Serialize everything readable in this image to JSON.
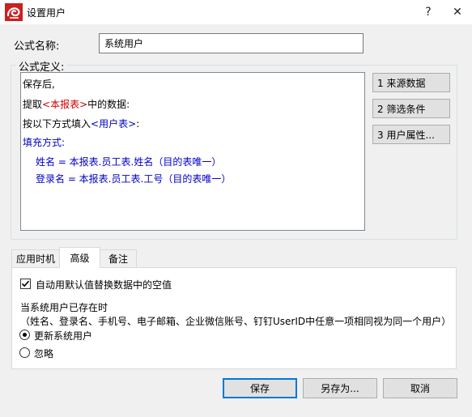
{
  "window": {
    "title": "设置用户",
    "help_label": "?",
    "close_label": "✕"
  },
  "formula_name": {
    "label": "公式名称:",
    "value": "系统用户"
  },
  "definition": {
    "label": "公式定义:",
    "lines": {
      "l1": {
        "text": "保存后,"
      },
      "l2": {
        "prefix": "提取",
        "highlight": "<本报表>",
        "suffix": "中的数据:"
      },
      "l3": {
        "prefix": "按以下方式填入",
        "highlight": "<用户表>",
        "suffix": ":"
      },
      "l4": {
        "text": "填充方式:"
      },
      "l5": {
        "text": "姓名 = 本报表.员工表.姓名（目的表唯一）"
      },
      "l6": {
        "text": "登录名 = 本报表.员工表.工号（目的表唯一）"
      }
    },
    "colors": {
      "black": "#000000",
      "red": "#cc0000",
      "blue": "#0000c0"
    }
  },
  "side_buttons": {
    "source": "1  来源数据",
    "filter": "2  筛选条件",
    "attributes": "3 用户属性..."
  },
  "tabs": {
    "timing": "应用时机",
    "advanced": "高级",
    "notes": "备注",
    "active": "高级"
  },
  "advanced": {
    "auto_replace": {
      "label": "自动用默认值替换数据中的空值",
      "checked": true
    },
    "exists_heading": "当系统用户已存在时",
    "exists_note": "（姓名、登录名、手机号、电子邮箱、企业微信账号、钉钉UserID中任意一项相同视为同一个用户）",
    "option_update": {
      "label": "更新系统用户",
      "selected": true
    },
    "option_ignore": {
      "label": "忽略",
      "selected": false
    }
  },
  "footer": {
    "save": "保存",
    "save_as": "另存为...",
    "cancel": "取消"
  },
  "colors": {
    "accent": "#0078d7",
    "app_icon": "#cc1f1f"
  }
}
